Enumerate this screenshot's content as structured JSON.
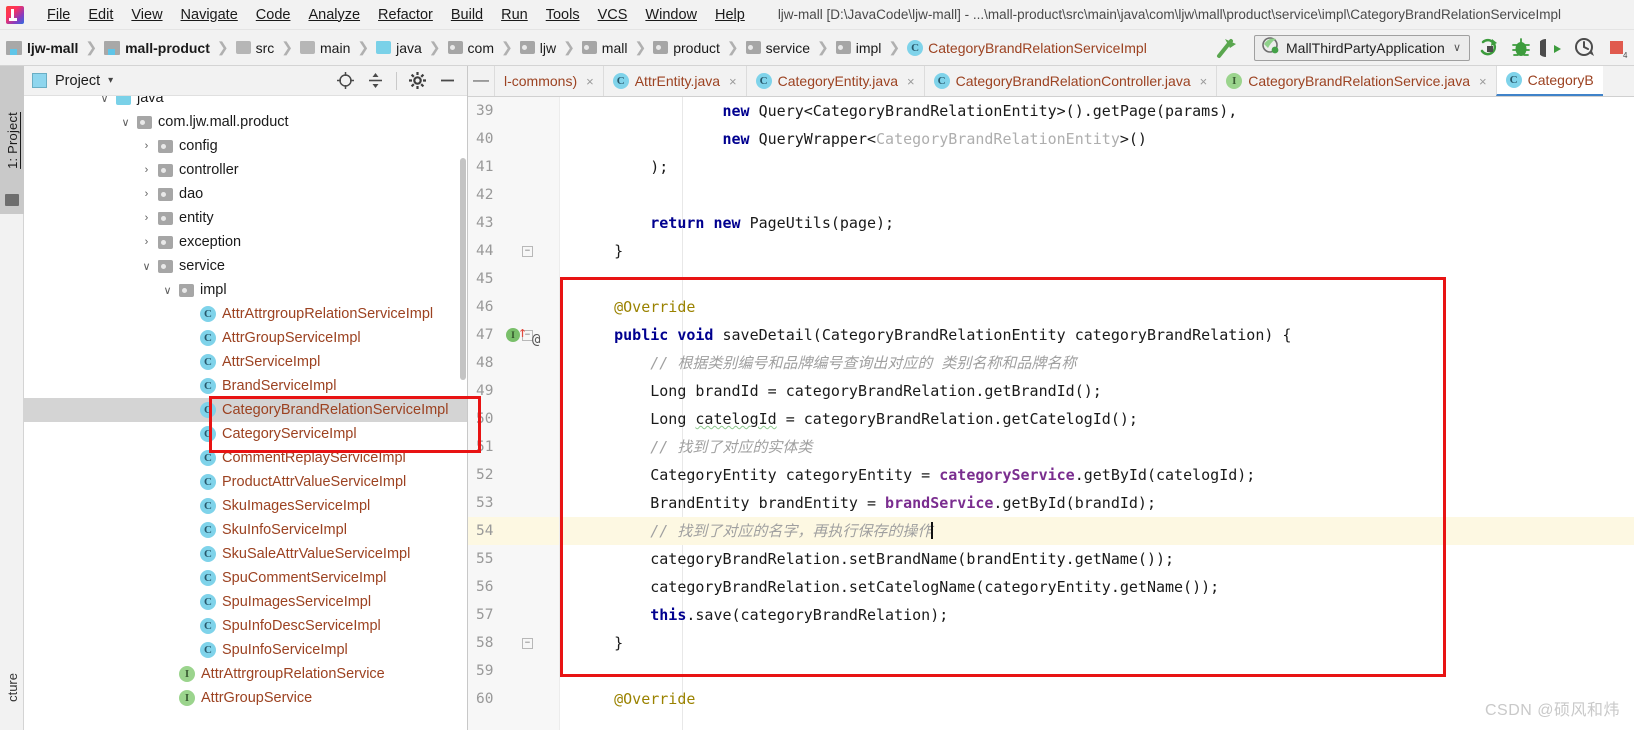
{
  "window": {
    "title": "ljw-mall [D:\\JavaCode\\ljw-mall] - ...\\mall-product\\src\\main\\java\\com\\ljw\\mall\\product\\service\\impl\\CategoryBrandRelationServiceImpl",
    "logo_name": "intellij-idea-logo"
  },
  "menubar": {
    "items": [
      {
        "label": "File"
      },
      {
        "label": "Edit"
      },
      {
        "label": "View"
      },
      {
        "label": "Navigate"
      },
      {
        "label": "Code"
      },
      {
        "label": "Analyze"
      },
      {
        "label": "Refactor"
      },
      {
        "label": "Build"
      },
      {
        "label": "Run"
      },
      {
        "label": "Tools"
      },
      {
        "label": "VCS"
      },
      {
        "label": "Window"
      },
      {
        "label": "Help"
      }
    ]
  },
  "breadcrumb": {
    "items": [
      {
        "label": "ljw-mall",
        "icon": "module-icon",
        "bold": true
      },
      {
        "label": "mall-product",
        "icon": "module-icon",
        "bold": true
      },
      {
        "label": "src",
        "icon": "folder-icon"
      },
      {
        "label": "main",
        "icon": "folder-icon"
      },
      {
        "label": "java",
        "icon": "source-folder-icon"
      },
      {
        "label": "com",
        "icon": "package-icon"
      },
      {
        "label": "ljw",
        "icon": "package-icon"
      },
      {
        "label": "mall",
        "icon": "package-icon"
      },
      {
        "label": "product",
        "icon": "package-icon"
      },
      {
        "label": "service",
        "icon": "package-icon"
      },
      {
        "label": "impl",
        "icon": "package-icon"
      },
      {
        "label": "CategoryBrandRelationServiceImpl",
        "icon": "class-icon",
        "orange": true
      }
    ],
    "separator": "❯"
  },
  "toolbar": {
    "build_icon": "hammer-icon",
    "run_configuration": "MallThirdPartyApplication",
    "dropdown_caret": "∨",
    "actions": [
      {
        "name": "run-icon"
      },
      {
        "name": "debug-icon"
      },
      {
        "name": "run-with-coverage-icon"
      },
      {
        "name": "profiler-icon"
      },
      {
        "name": "stop-icon"
      }
    ]
  },
  "tool_windows": {
    "left_tab": "1: Project",
    "bottom_tab": "cture"
  },
  "project_panel": {
    "title": "Project",
    "caret": "▾",
    "actions": [
      {
        "name": "locate-icon"
      },
      {
        "name": "collapse-all-icon"
      },
      {
        "name": "settings-gear-icon"
      },
      {
        "name": "hide-icon"
      }
    ],
    "tree": [
      {
        "label": "java",
        "icon": "source-folder-icon",
        "indent": 3,
        "arrow": "∨",
        "kind": "pkg",
        "partial": true
      },
      {
        "label": "com.ljw.mall.product",
        "icon": "package-icon",
        "indent": 4,
        "arrow": "∨",
        "kind": "pkg"
      },
      {
        "label": "config",
        "icon": "package-icon",
        "indent": 5,
        "arrow": "›",
        "kind": "pkg"
      },
      {
        "label": "controller",
        "icon": "package-icon",
        "indent": 5,
        "arrow": "›",
        "kind": "pkg"
      },
      {
        "label": "dao",
        "icon": "package-icon",
        "indent": 5,
        "arrow": "›",
        "kind": "pkg"
      },
      {
        "label": "entity",
        "icon": "package-icon",
        "indent": 5,
        "arrow": "›",
        "kind": "pkg"
      },
      {
        "label": "exception",
        "icon": "package-icon",
        "indent": 5,
        "arrow": "›",
        "kind": "pkg"
      },
      {
        "label": "service",
        "icon": "package-icon",
        "indent": 5,
        "arrow": "∨",
        "kind": "pkg"
      },
      {
        "label": "impl",
        "icon": "package-icon",
        "indent": 6,
        "arrow": "∨",
        "kind": "pkg"
      },
      {
        "label": "AttrAttrgroupRelationServiceImpl",
        "icon": "class-icon",
        "indent": 7,
        "arrow": "",
        "kind": "cls"
      },
      {
        "label": "AttrGroupServiceImpl",
        "icon": "class-icon",
        "indent": 7,
        "arrow": "",
        "kind": "cls"
      },
      {
        "label": "AttrServiceImpl",
        "icon": "class-icon",
        "indent": 7,
        "arrow": "",
        "kind": "cls"
      },
      {
        "label": "BrandServiceImpl",
        "icon": "class-icon",
        "indent": 7,
        "arrow": "",
        "kind": "cls"
      },
      {
        "label": "CategoryBrandRelationServiceImpl",
        "icon": "class-icon",
        "indent": 7,
        "arrow": "",
        "kind": "cls",
        "selected": true
      },
      {
        "label": "CategoryServiceImpl",
        "icon": "class-icon",
        "indent": 7,
        "arrow": "",
        "kind": "cls"
      },
      {
        "label": "CommentReplayServiceImpl",
        "icon": "class-icon",
        "indent": 7,
        "arrow": "",
        "kind": "cls"
      },
      {
        "label": "ProductAttrValueServiceImpl",
        "icon": "class-icon",
        "indent": 7,
        "arrow": "",
        "kind": "cls"
      },
      {
        "label": "SkuImagesServiceImpl",
        "icon": "class-icon",
        "indent": 7,
        "arrow": "",
        "kind": "cls"
      },
      {
        "label": "SkuInfoServiceImpl",
        "icon": "class-icon",
        "indent": 7,
        "arrow": "",
        "kind": "cls"
      },
      {
        "label": "SkuSaleAttrValueServiceImpl",
        "icon": "class-icon",
        "indent": 7,
        "arrow": "",
        "kind": "cls"
      },
      {
        "label": "SpuCommentServiceImpl",
        "icon": "class-icon",
        "indent": 7,
        "arrow": "",
        "kind": "cls"
      },
      {
        "label": "SpuImagesServiceImpl",
        "icon": "class-icon",
        "indent": 7,
        "arrow": "",
        "kind": "cls"
      },
      {
        "label": "SpuInfoDescServiceImpl",
        "icon": "class-icon",
        "indent": 7,
        "arrow": "",
        "kind": "cls"
      },
      {
        "label": "SpuInfoServiceImpl",
        "icon": "class-icon",
        "indent": 7,
        "arrow": "",
        "kind": "cls"
      },
      {
        "label": "AttrAttrgroupRelationService",
        "icon": "interface-icon",
        "indent": 6,
        "arrow": "",
        "kind": "cls"
      },
      {
        "label": "AttrGroupService",
        "icon": "interface-icon",
        "indent": 6,
        "arrow": "",
        "kind": "cls"
      }
    ]
  },
  "editor_tabs": [
    {
      "label": "l-commons)",
      "icon": "",
      "close": "×",
      "active": false
    },
    {
      "label": "AttrEntity.java",
      "icon": "class-icon",
      "close": "×",
      "active": false
    },
    {
      "label": "CategoryEntity.java",
      "icon": "class-icon",
      "close": "×",
      "active": false
    },
    {
      "label": "CategoryBrandRelationController.java",
      "icon": "class-icon",
      "close": "×",
      "active": false
    },
    {
      "label": "CategoryBrandRelationService.java",
      "icon": "interface-icon",
      "close": "×",
      "active": false
    },
    {
      "label": "CategoryB",
      "icon": "class-icon",
      "close": "",
      "active": true
    }
  ],
  "code": {
    "first_line_number": 39,
    "lines": [
      {
        "n": 39,
        "text": "                new Query<CategoryBrandRelationEntity>().getPage(params),"
      },
      {
        "n": 40,
        "text": "                new QueryWrapper<CategoryBrandRelationEntity>()"
      },
      {
        "n": 41,
        "text": "        );"
      },
      {
        "n": 42,
        "text": ""
      },
      {
        "n": 43,
        "text": "        return new PageUtils(page);"
      },
      {
        "n": 44,
        "text": "    }"
      },
      {
        "n": 45,
        "text": ""
      },
      {
        "n": 46,
        "text": "    @Override"
      },
      {
        "n": 47,
        "text": "    public void saveDetail(CategoryBrandRelationEntity categoryBrandRelation) {"
      },
      {
        "n": 48,
        "text": "        // 根据类别编号和品牌编号查询出对应的 类别名称和品牌名称"
      },
      {
        "n": 49,
        "text": "        Long brandId = categoryBrandRelation.getBrandId();"
      },
      {
        "n": 50,
        "text": "        Long catelogId = categoryBrandRelation.getCatelogId();"
      },
      {
        "n": 51,
        "text": "        // 找到了对应的实体类"
      },
      {
        "n": 52,
        "text": "        CategoryEntity categoryEntity = categoryService.getById(catelogId);"
      },
      {
        "n": 53,
        "text": "        BrandEntity brandEntity = brandService.getById(brandId);"
      },
      {
        "n": 54,
        "text": "        // 找到了对应的名字，再执行保存的操作",
        "highlight": true
      },
      {
        "n": 55,
        "text": "        categoryBrandRelation.setBrandName(brandEntity.getName());"
      },
      {
        "n": 56,
        "text": "        categoryBrandRelation.setCatelogName(categoryEntity.getName());"
      },
      {
        "n": 57,
        "text": "        this.save(categoryBrandRelation);"
      },
      {
        "n": 58,
        "text": "    }"
      },
      {
        "n": 59,
        "text": ""
      },
      {
        "n": 60,
        "text": "    @Override"
      }
    ],
    "cursor_line": 54,
    "gutter_markers": {
      "line_47": [
        "implements-interface-icon",
        "override-arrow-icon",
        "annotation-icon"
      ],
      "fold_lines": [
        44,
        47,
        58
      ]
    }
  },
  "annotations": {
    "highlight_color": "#e81313",
    "boxes": [
      {
        "name": "code-method-highlight"
      },
      {
        "name": "tree-file-highlight"
      }
    ]
  },
  "watermark": "CSDN @硕风和炜"
}
